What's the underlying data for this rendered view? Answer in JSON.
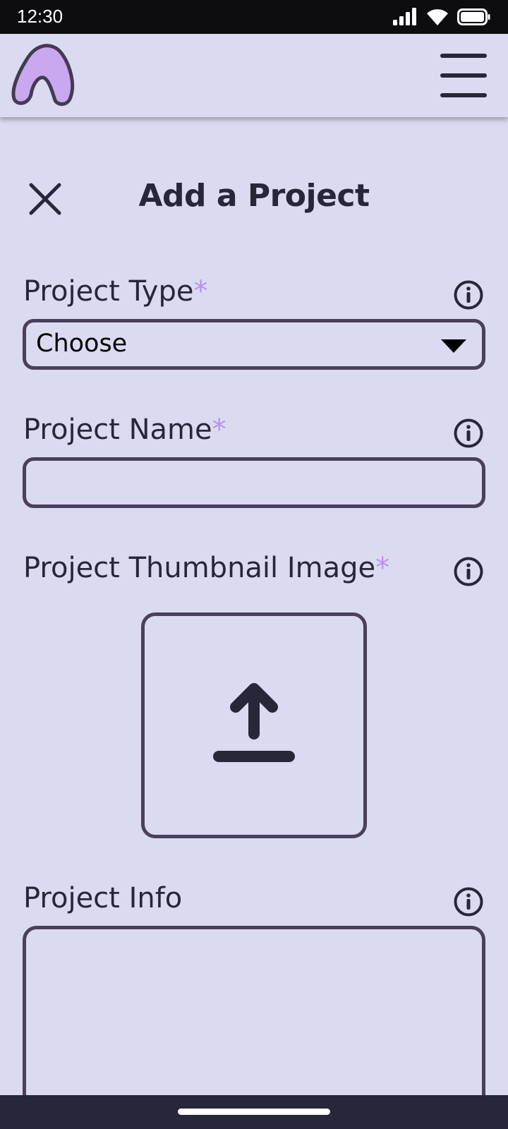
{
  "status_bar": {
    "time": "12:30",
    "icons": [
      "signal-icon",
      "wifi-icon",
      "battery-icon"
    ]
  },
  "header": {
    "logo_icon": "app-logo-icon",
    "menu_icon": "hamburger-menu-icon"
  },
  "dialog": {
    "title": "Add a Project",
    "close_icon": "close-icon"
  },
  "form": {
    "required_marker": "*",
    "project_type": {
      "label": "Project Type",
      "required": true,
      "selected": "Choose"
    },
    "project_name": {
      "label": "Project Name",
      "required": true,
      "value": ""
    },
    "thumbnail": {
      "label": "Project Thumbnail Image",
      "required": true,
      "icon": "upload-icon"
    },
    "project_info": {
      "label": "Project Info",
      "required": false,
      "value": ""
    }
  },
  "colors": {
    "background": "#dadbf1",
    "text": "#262738",
    "border": "#4a3f5c",
    "required_accent": "#b991ed",
    "logo_fill": "#c9a8f0",
    "status_bar": "#0d0d0f",
    "nav_bar": "#26273a"
  }
}
